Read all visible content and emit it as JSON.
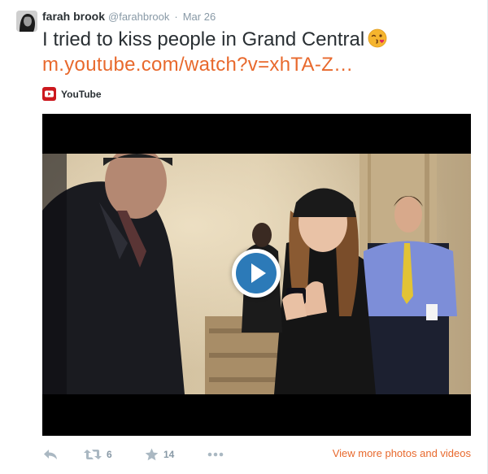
{
  "tweet": {
    "fullname": "farah brook",
    "handle": "@farahbrook",
    "separator": "·",
    "date": "Mar 26",
    "text": "I tried to kiss people in Grand Central",
    "emoji": "kissing-face-emoji",
    "link": "m.youtube.com/watch?v=xhTA-Z…"
  },
  "card": {
    "source_name": "YouTube",
    "source_icon": "youtube-icon",
    "play_icon": "play-icon"
  },
  "actions": {
    "reply_icon": "reply-icon",
    "retweet_icon": "retweet-icon",
    "retweet_count": "6",
    "favorite_icon": "star-icon",
    "favorite_count": "14",
    "more_icon": "ellipsis-icon",
    "view_more": "View more photos and videos"
  },
  "colors": {
    "link": "#e8692d",
    "muted": "#8899a6",
    "text": "#292f33",
    "youtube_red": "#cc181e",
    "play_blue": "#2c7ab8"
  }
}
